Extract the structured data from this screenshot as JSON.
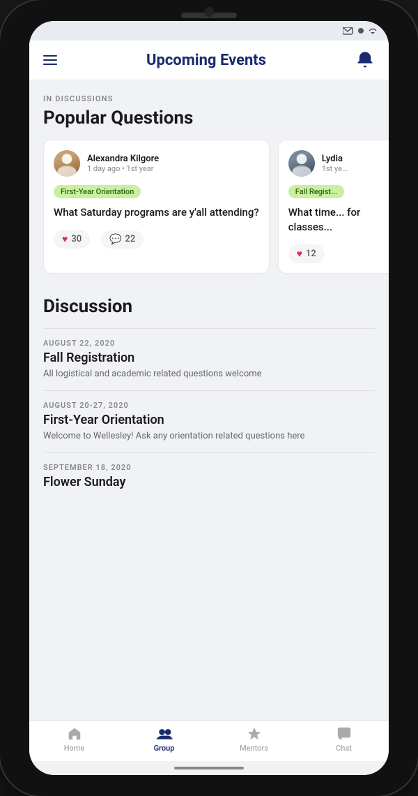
{
  "statusBar": {
    "icons": [
      "message",
      "circle",
      "wifi"
    ]
  },
  "header": {
    "title": "Upcoming Events",
    "bellLabel": "notifications"
  },
  "popularQuestions": {
    "sectionLabel": "IN DISCUSSIONS",
    "sectionTitle": "Popular Questions",
    "cards": [
      {
        "userName": "Alexandra Kilgore",
        "userMeta": "1 day ago • 1st year",
        "tag": "First-Year Orientation",
        "question": "What Saturday programs are y'all attending?",
        "likes": "30",
        "comments": "22"
      },
      {
        "userName": "Lydia",
        "userMeta": "1st ye...",
        "tag": "Fall Regist...",
        "question": "What time... for classes...",
        "likes": "12",
        "comments": ""
      }
    ]
  },
  "discussion": {
    "title": "Discussion",
    "items": [
      {
        "date": "AUGUST 22, 2020",
        "name": "Fall Registration",
        "desc": "All logistical and academic related questions welcome"
      },
      {
        "date": "AUGUST 20-27, 2020",
        "name": "First-Year Orientation",
        "desc": "Welcome to Wellesley! Ask any orientation related questions here"
      },
      {
        "date": "SEPTEMBER 18, 2020",
        "name": "Flower Sunday",
        "desc": ""
      }
    ]
  },
  "bottomNav": {
    "items": [
      {
        "label": "Home",
        "icon": "🏠",
        "active": false
      },
      {
        "label": "Group",
        "icon": "👥",
        "active": true
      },
      {
        "label": "Mentors",
        "icon": "★",
        "active": false
      },
      {
        "label": "Chat",
        "icon": "💬",
        "active": false
      }
    ]
  }
}
